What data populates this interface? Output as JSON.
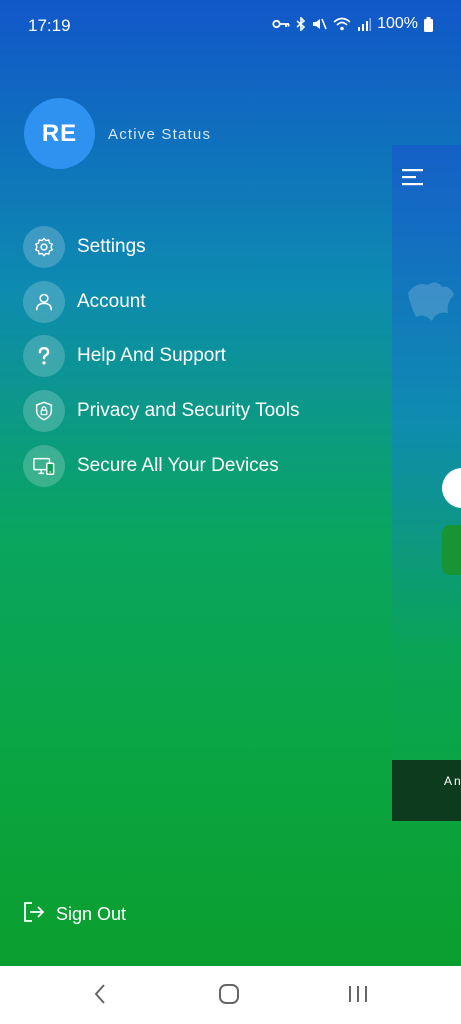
{
  "status_bar": {
    "time": "17:19",
    "battery": "100%"
  },
  "profile": {
    "initials": "RE",
    "status": "Active Status",
    "avatar_color": "#2f92f0"
  },
  "menu": {
    "items": [
      {
        "label": "Settings",
        "icon": "gear-icon"
      },
      {
        "label": "Account",
        "icon": "user-icon"
      },
      {
        "label": "Help And Support",
        "icon": "question-icon"
      },
      {
        "label": "Privacy and Security Tools",
        "icon": "shield-lock-icon"
      },
      {
        "label": "Secure All Your Devices",
        "icon": "devices-icon"
      }
    ]
  },
  "sign_out": {
    "label": "Sign Out",
    "icon": "sign-out-icon"
  },
  "background_app": {
    "bottom_text": "An"
  },
  "colors": {
    "gradient_top": "#1157c9",
    "gradient_bottom": "#0b9e2f"
  }
}
